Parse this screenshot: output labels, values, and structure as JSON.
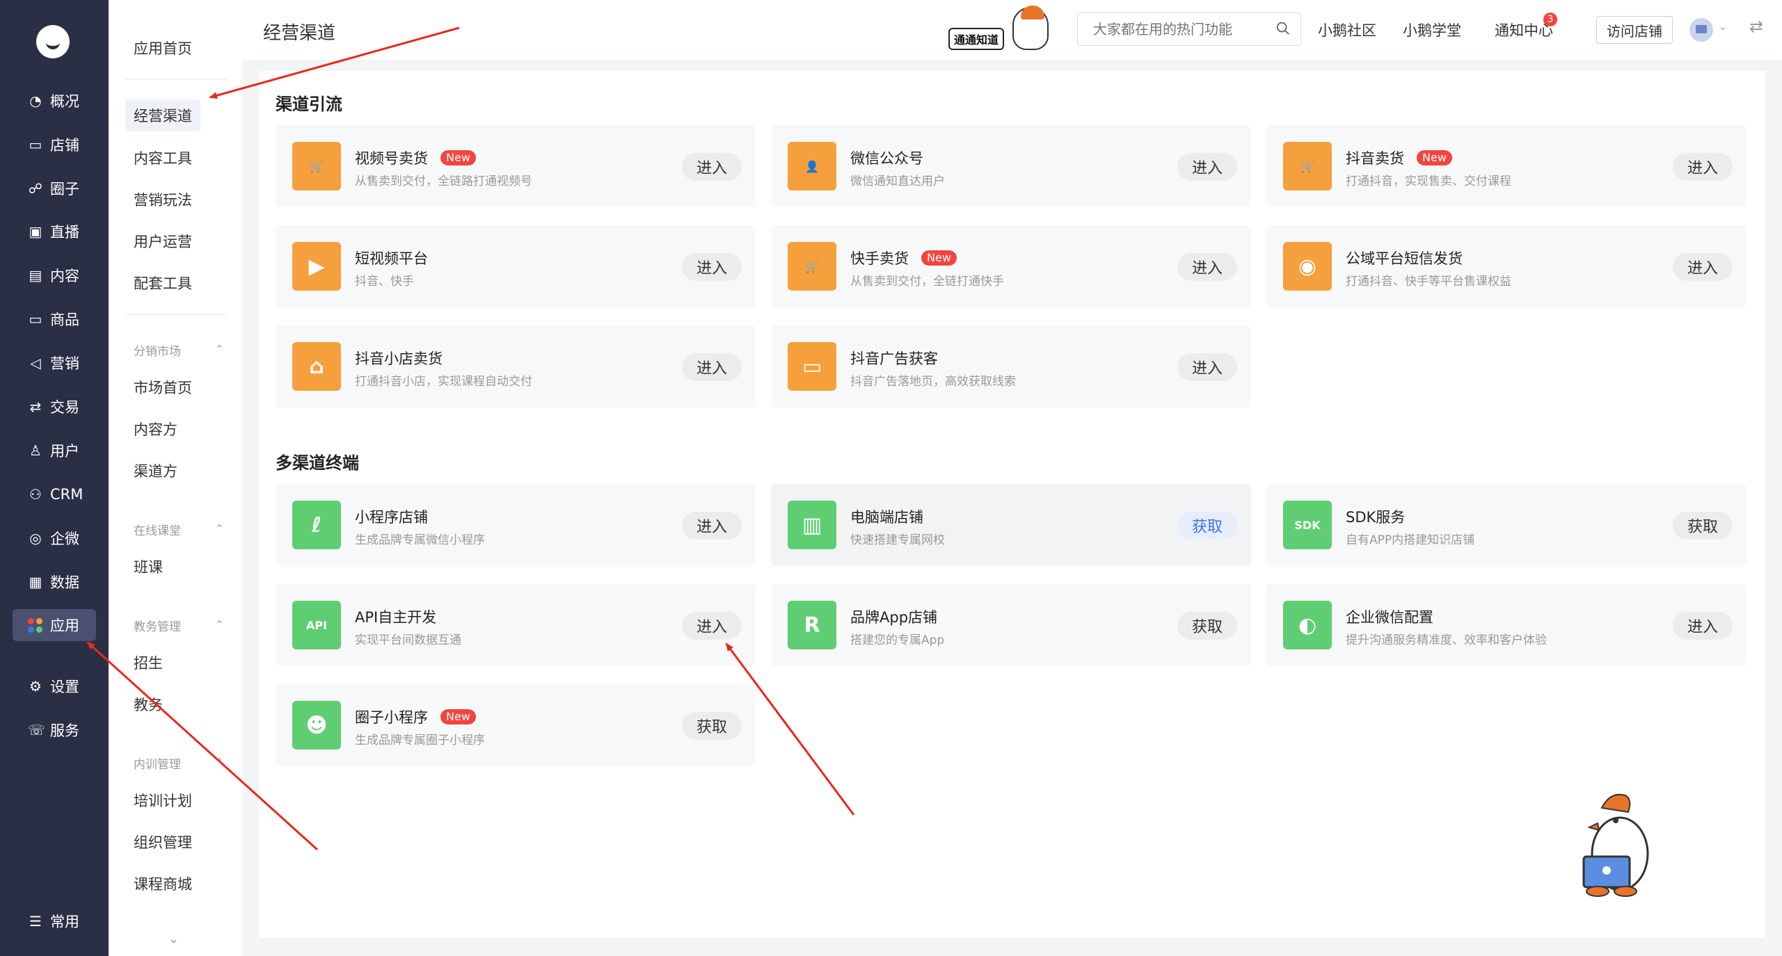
{
  "nav": {
    "items": [
      {
        "icon": "overview-icon",
        "glyph": "◔",
        "label": "概况"
      },
      {
        "icon": "store-icon",
        "glyph": "▭",
        "label": "店铺"
      },
      {
        "icon": "circle-icon",
        "glyph": "☍",
        "label": "圈子"
      },
      {
        "icon": "live-icon",
        "glyph": "▣",
        "label": "直播"
      },
      {
        "icon": "content-icon",
        "glyph": "▤",
        "label": "内容"
      },
      {
        "icon": "goods-icon",
        "glyph": "▭",
        "label": "商品"
      },
      {
        "icon": "marketing-icon",
        "glyph": "◁",
        "label": "营销"
      },
      {
        "icon": "trade-icon",
        "glyph": "⇄",
        "label": "交易"
      },
      {
        "icon": "user-icon",
        "glyph": "♙",
        "label": "用户"
      },
      {
        "icon": "crm-icon",
        "glyph": "⚇",
        "label": "CRM"
      },
      {
        "icon": "wecom-icon",
        "glyph": "◎",
        "label": "企微"
      },
      {
        "icon": "data-icon",
        "glyph": "▦",
        "label": "数据"
      },
      {
        "icon": "apps-icon",
        "glyph": "",
        "label": "应用"
      },
      {
        "icon": "settings-icon",
        "glyph": "⚙",
        "label": "设置"
      },
      {
        "icon": "service-icon",
        "glyph": "☏",
        "label": "服务"
      }
    ],
    "bottom": {
      "icon": "menu-icon",
      "glyph": "☰",
      "label": "常用"
    }
  },
  "subnav": {
    "top": [
      "应用首页"
    ],
    "active": "经营渠道",
    "items": [
      "内容工具",
      "营销玩法",
      "用户运营",
      "配套工具"
    ],
    "groups": [
      {
        "title": "分销市场",
        "items": [
          "市场首页",
          "内容方",
          "渠道方"
        ]
      },
      {
        "title": "在线课堂",
        "items": [
          "班课"
        ]
      },
      {
        "title": "教务管理",
        "items": [
          "招生",
          "教务"
        ]
      },
      {
        "title": "内训管理",
        "items": [
          "培训计划",
          "组织管理",
          "课程商城"
        ]
      }
    ]
  },
  "topbar": {
    "title": "经营渠道",
    "banner": "通通知道",
    "search_placeholder": "大家都在用的热门功能",
    "links": [
      "小鹅社区",
      "小鹅学堂",
      "通知中心"
    ],
    "notification_count": "3",
    "visit_store": "访问店铺"
  },
  "sections": [
    {
      "title": "渠道引流",
      "cards": [
        {
          "name": "视频号卖货",
          "new": "New",
          "desc": "从售卖到交付，全链路打通视频号",
          "action": "进入",
          "color": "orange",
          "glyph": "🛒"
        },
        {
          "name": "微信公众号",
          "new": "",
          "desc": "微信通知直达用户",
          "action": "进入",
          "color": "orange",
          "glyph": "👤"
        },
        {
          "name": "抖音卖货",
          "new": "New",
          "desc": "打通抖音，实现售卖、交付课程",
          "action": "进入",
          "color": "orange",
          "glyph": "🛒"
        },
        {
          "name": "短视频平台",
          "new": "",
          "desc": "抖音、快手",
          "action": "进入",
          "color": "orange",
          "glyph": "▶"
        },
        {
          "name": "快手卖货",
          "new": "New",
          "desc": "从售卖到交付，全链打通快手",
          "action": "进入",
          "color": "orange",
          "glyph": "🛒"
        },
        {
          "name": "公域平台短信发货",
          "new": "",
          "desc": "打通抖音、快手等平台售课权益",
          "action": "进入",
          "color": "orange",
          "glyph": "◉"
        },
        {
          "name": "抖音小店卖货",
          "new": "",
          "desc": "打通抖音小店，实现课程自动交付",
          "action": "进入",
          "color": "orange",
          "glyph": "⌂"
        },
        {
          "name": "抖音广告获客",
          "new": "",
          "desc": "抖音广告落地页，高效获取线索",
          "action": "进入",
          "color": "orange",
          "glyph": "▭"
        }
      ]
    },
    {
      "title": "多渠道终端",
      "cards": [
        {
          "name": "小程序店铺",
          "new": "",
          "desc": "生成品牌专属微信小程序",
          "action": "进入",
          "color": "green",
          "glyph": "ℓ"
        },
        {
          "name": "电脑端店铺",
          "new": "",
          "desc": "快速搭建专属网校",
          "action": "获取",
          "color": "green",
          "glyph": "▥",
          "highlight": true
        },
        {
          "name": "SDK服务",
          "new": "",
          "desc": "自有APP内搭建知识店铺",
          "action": "获取",
          "color": "green",
          "glyph": "SDK"
        },
        {
          "name": "API自主开发",
          "new": "",
          "desc": "实现平台间数据互通",
          "action": "进入",
          "color": "green",
          "glyph": "API"
        },
        {
          "name": "品牌App店铺",
          "new": "",
          "desc": "搭建您的专属App",
          "action": "获取",
          "color": "green",
          "glyph": "R"
        },
        {
          "name": "企业微信配置",
          "new": "",
          "desc": "提升沟通服务精准度、效率和客户体验",
          "action": "进入",
          "color": "green",
          "glyph": "◐"
        },
        {
          "name": "圈子小程序",
          "new": "New",
          "desc": "生成品牌专属圈子小程序",
          "action": "获取",
          "color": "green",
          "glyph": "☻"
        }
      ]
    }
  ],
  "colors": {
    "nav_bg": "#2a2f45",
    "orange": "#f5a03c",
    "green": "#5fce73",
    "new_tag": "#f2453d",
    "arrow": "#e8281e",
    "accent_blue": "#3d74e8"
  }
}
